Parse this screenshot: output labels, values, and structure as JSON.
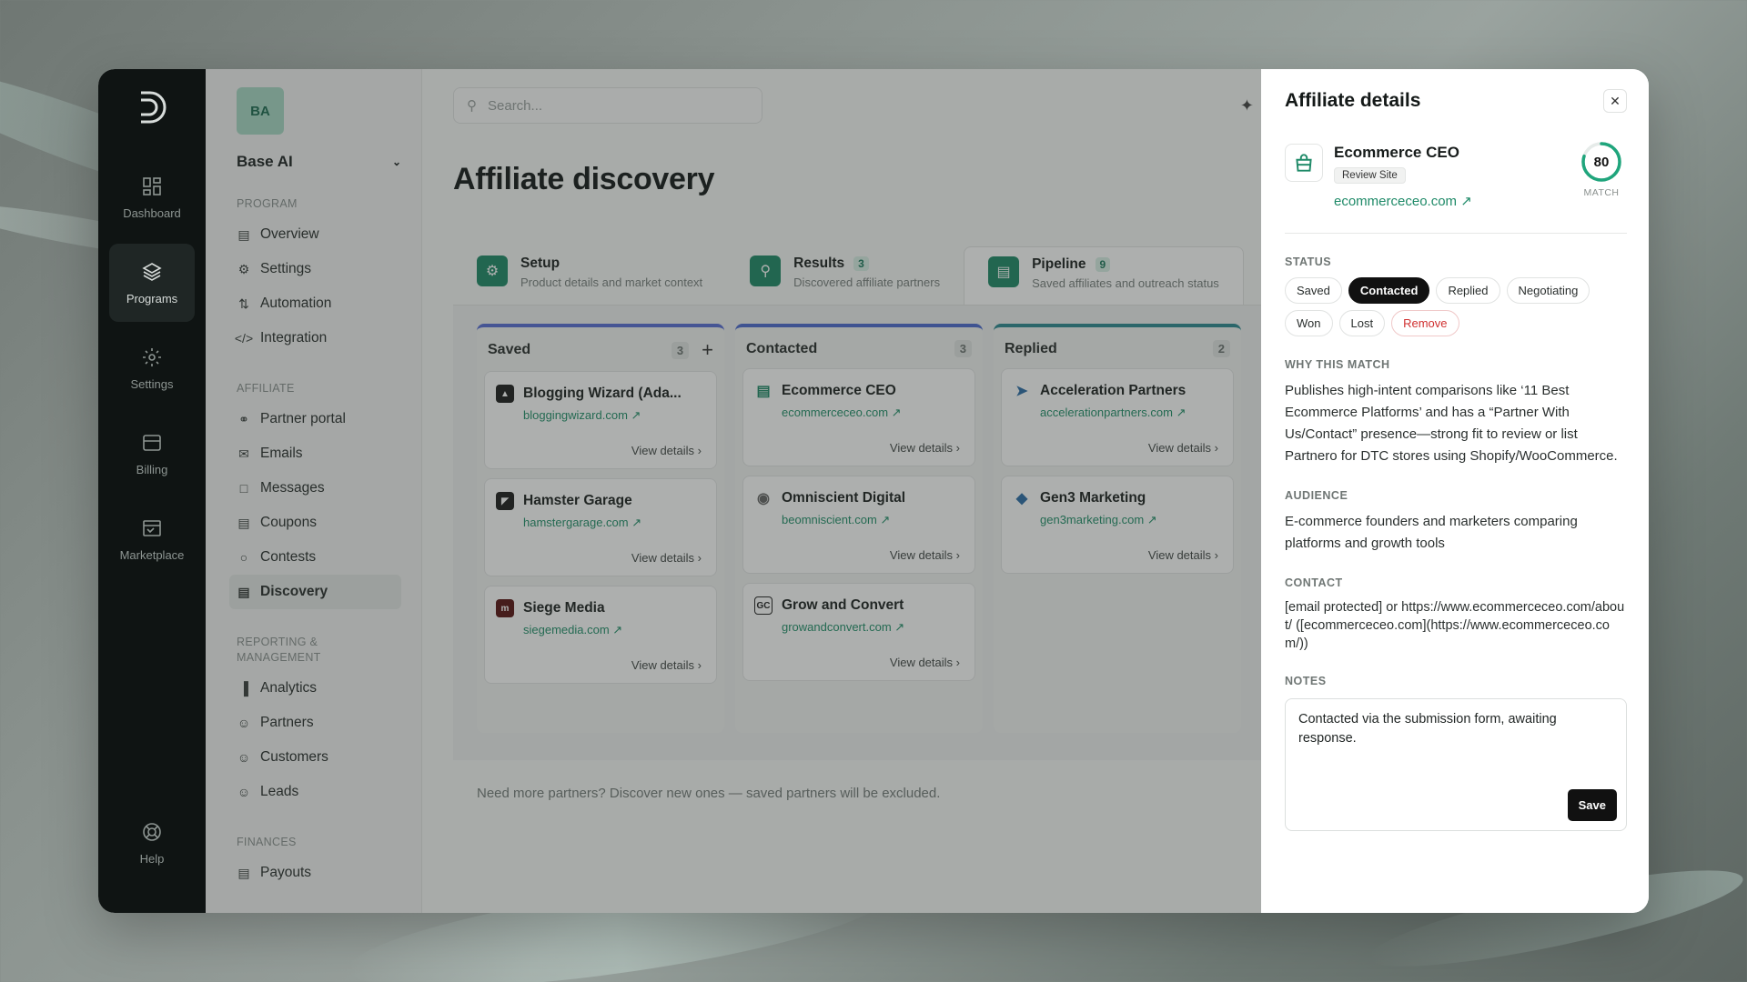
{
  "rail": {
    "items": [
      {
        "label": "Dashboard"
      },
      {
        "label": "Programs"
      },
      {
        "label": "Settings"
      },
      {
        "label": "Billing"
      },
      {
        "label": "Marketplace"
      }
    ],
    "help": "Help"
  },
  "sidebar": {
    "workspace_badge": "BA",
    "workspace_name": "Base AI",
    "sections": {
      "program": "PROGRAM",
      "affiliate": "AFFILIATE",
      "reporting": "REPORTING & MANAGEMENT",
      "finances": "FINANCES"
    },
    "program_items": [
      {
        "label": "Overview",
        "icon": "doc-icon"
      },
      {
        "label": "Settings",
        "icon": "gear-icon"
      },
      {
        "label": "Automation",
        "icon": "automation-icon"
      },
      {
        "label": "Integration",
        "icon": "code-icon"
      }
    ],
    "affiliate_items": [
      {
        "label": "Partner portal",
        "icon": "globe-icon"
      },
      {
        "label": "Emails",
        "icon": "mail-icon"
      },
      {
        "label": "Messages",
        "icon": "message-icon"
      },
      {
        "label": "Coupons",
        "icon": "coupon-icon"
      },
      {
        "label": "Contests",
        "icon": "trophy-icon"
      },
      {
        "label": "Discovery",
        "icon": "discovery-icon"
      }
    ],
    "reporting_items": [
      {
        "label": "Analytics",
        "icon": "chart-icon"
      },
      {
        "label": "Partners",
        "icon": "partners-icon"
      },
      {
        "label": "Customers",
        "icon": "customers-icon"
      },
      {
        "label": "Leads",
        "icon": "leads-icon"
      }
    ],
    "finances_items": [
      {
        "label": "Payouts",
        "icon": "payouts-icon"
      }
    ]
  },
  "main": {
    "search_placeholder": "Search...",
    "title": "Affiliate discovery",
    "steps": [
      {
        "title": "Setup",
        "desc": "Product details and market context",
        "count": ""
      },
      {
        "title": "Results",
        "desc": "Discovered affiliate partners",
        "count": "3"
      },
      {
        "title": "Pipeline",
        "desc": "Saved affiliates and outreach status",
        "count": "9"
      }
    ],
    "columns": [
      {
        "title": "Saved",
        "count": "3",
        "cards": [
          {
            "name": "Blogging Wizard (Ada...",
            "link": "bloggingwizard.com",
            "action": "View details"
          },
          {
            "name": "Hamster Garage",
            "link": "hamstergarage.com",
            "action": "View details"
          },
          {
            "name": "Siege Media",
            "link": "siegemedia.com",
            "action": "View details"
          }
        ]
      },
      {
        "title": "Contacted",
        "count": "3",
        "cards": [
          {
            "name": "Ecommerce CEO",
            "link": "ecommerceceo.com",
            "action": "View details"
          },
          {
            "name": "Omniscient Digital",
            "link": "beomniscient.com",
            "action": "View details"
          },
          {
            "name": "Grow and Convert",
            "link": "growandconvert.com",
            "action": "View details"
          }
        ]
      },
      {
        "title": "Replied",
        "count": "2",
        "cards": [
          {
            "name": "Acceleration Partners",
            "link": "accelerationpartners.com",
            "action": "View details"
          },
          {
            "name": "Gen3 Marketing",
            "link": "gen3marketing.com",
            "action": "View details"
          }
        ]
      }
    ],
    "hint": "Need more partners? Discover new ones — saved partners will be excluded."
  },
  "panel": {
    "title": "Affiliate details",
    "name": "Ecommerce CEO",
    "tag": "Review Site",
    "link": "ecommerceceo.com ↗",
    "match_score": "80",
    "match_label": "MATCH",
    "status_label": "STATUS",
    "statuses": [
      "Saved",
      "Contacted",
      "Replied",
      "Negotiating",
      "Won",
      "Lost",
      "Remove"
    ],
    "selected_status": "Contacted",
    "why_label": "WHY THIS MATCH",
    "why_text": "Publishes high-intent comparisons like ‘11 Best Ecommerce Platforms’ and has a “Partner With Us/Contact” presence—strong fit to review or list Partnero for DTC stores using Shopify/WooCommerce.",
    "audience_label": "AUDIENCE",
    "audience_text": "E-commerce founders and marketers comparing platforms and growth tools",
    "contact_label": "CONTACT",
    "contact_text": "[email protected] or https://www.ecommerceceo.com/about/ ([ecommerceceo.com](https://www.ecommerceceo.com/))",
    "notes_label": "NOTES",
    "notes_text": "Contacted via the submission form, awaiting response.",
    "save_label": "Save"
  },
  "colors": {
    "accent": "#1f8a68",
    "rail_bg": "#0f1413",
    "danger": "#d03030"
  }
}
